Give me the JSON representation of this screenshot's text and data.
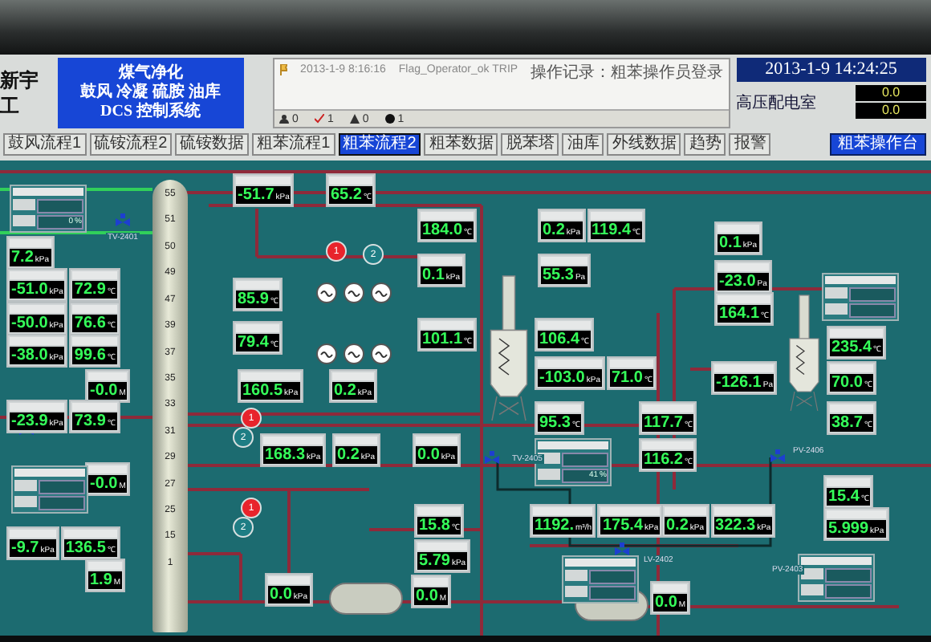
{
  "header": {
    "company": [
      "新宇",
      "工"
    ],
    "title_lines": [
      "煤气净化",
      "鼓风 冷凝 硫胺 油库",
      "DCS 控制系统"
    ],
    "event_log": {
      "entries": [
        {
          "time": "2013-1-9 8:16:16",
          "tag": "Flag_Operator_ok TRIP",
          "message": "操作记录：粗苯操作员登录"
        }
      ],
      "counters": [
        {
          "kind": "person",
          "count": "0"
        },
        {
          "kind": "check",
          "count": "1"
        },
        {
          "kind": "warning",
          "count": "0"
        },
        {
          "kind": "dot",
          "count": "1"
        }
      ]
    },
    "datetime": "2013-1-9 14:24:25",
    "substation": {
      "label": "高压配电室",
      "values": [
        "0.0",
        "0.0"
      ]
    }
  },
  "nav": [
    {
      "label": "鼓风流程1",
      "selected": false
    },
    {
      "label": "硫铵流程2",
      "selected": false
    },
    {
      "label": "硫铵数据",
      "selected": false
    },
    {
      "label": "粗苯流程1",
      "selected": false
    },
    {
      "label": "粗苯流程2",
      "selected": true
    },
    {
      "label": "粗苯数据",
      "selected": false
    },
    {
      "label": "脱苯塔",
      "selected": false
    },
    {
      "label": "油库",
      "selected": false
    },
    {
      "label": "外线数据",
      "selected": false
    },
    {
      "label": "趋势",
      "selected": false
    },
    {
      "label": "报警",
      "selected": false
    }
  ],
  "console_button": "粗苯操作台",
  "gauges": [
    {
      "cells": [
        {
          "value": "7.2",
          "unit": "kPa"
        }
      ]
    },
    {
      "cells": [
        {
          "value": "-51.0",
          "unit": "kPa"
        },
        {
          "value": "72.9",
          "unit": "℃"
        }
      ]
    },
    {
      "cells": [
        {
          "value": "-50.0",
          "unit": "kPa"
        },
        {
          "value": "76.6",
          "unit": "℃"
        }
      ]
    },
    {
      "cells": [
        {
          "value": "-38.0",
          "unit": "kPa"
        },
        {
          "value": "99.6",
          "unit": "℃"
        }
      ]
    },
    {
      "cells": [
        {
          "value": "-0.0",
          "unit": "M"
        }
      ]
    },
    {
      "cells": [
        {
          "value": "-23.9",
          "unit": "kPa"
        },
        {
          "value": "73.9",
          "unit": "℃"
        }
      ]
    },
    {
      "cells": [
        {
          "value": "-0.0",
          "unit": "M"
        }
      ]
    },
    {
      "cells": [
        {
          "value": "-9.7",
          "unit": "kPa"
        },
        {
          "value": "136.5",
          "unit": "℃"
        }
      ]
    },
    {
      "cells": [
        {
          "value": "1.9",
          "unit": "M"
        }
      ]
    },
    {
      "cells": [
        {
          "value": "-51.7",
          "unit": "kPa"
        }
      ]
    },
    {
      "cells": [
        {
          "value": "85.9",
          "unit": "℃"
        }
      ]
    },
    {
      "cells": [
        {
          "value": "79.4",
          "unit": "℃"
        }
      ]
    },
    {
      "cells": [
        {
          "value": "160.5",
          "unit": "kPa"
        }
      ]
    },
    {
      "cells": [
        {
          "value": "168.3",
          "unit": "kPa"
        }
      ]
    },
    {
      "cells": [
        {
          "value": "0.0",
          "unit": "kPa"
        }
      ]
    },
    {
      "cells": [
        {
          "value": "65.2",
          "unit": "℃"
        }
      ]
    },
    {
      "cells": [
        {
          "value": "184.0",
          "unit": "℃"
        }
      ]
    },
    {
      "cells": [
        {
          "value": "0.1",
          "unit": "kPa"
        }
      ]
    },
    {
      "cells": [
        {
          "value": "101.1",
          "unit": "℃"
        }
      ]
    },
    {
      "cells": [
        {
          "value": "0.2",
          "unit": "kPa"
        }
      ]
    },
    {
      "cells": [
        {
          "value": "0.2",
          "unit": "kPa"
        }
      ]
    },
    {
      "cells": [
        {
          "value": "0.0",
          "unit": "kPa"
        }
      ]
    },
    {
      "cells": [
        {
          "value": "15.8",
          "unit": "℃"
        }
      ]
    },
    {
      "cells": [
        {
          "value": "5.79",
          "unit": "kPa"
        }
      ]
    },
    {
      "cells": [
        {
          "value": "0.0",
          "unit": "M"
        }
      ]
    },
    {
      "cells": [
        {
          "value": "0.2",
          "unit": "kPa"
        },
        {
          "value": "119.4",
          "unit": "℃"
        }
      ]
    },
    {
      "cells": [
        {
          "value": "55.3",
          "unit": "Pa"
        }
      ]
    },
    {
      "cells": [
        {
          "value": "106.4",
          "unit": "℃"
        }
      ]
    },
    {
      "cells": [
        {
          "value": "-103.0",
          "unit": "kPa"
        },
        {
          "value": "71.0",
          "unit": "℃"
        }
      ]
    },
    {
      "cells": [
        {
          "value": "95.3",
          "unit": "℃"
        }
      ]
    },
    {
      "cells": [
        {
          "value": "1192.",
          "unit": "m³/h"
        },
        {
          "value": "175.4",
          "unit": "kPa"
        }
      ]
    },
    {
      "cells": [
        {
          "value": "117.7",
          "unit": "℃"
        }
      ]
    },
    {
      "cells": [
        {
          "value": "116.2",
          "unit": "℃"
        }
      ]
    },
    {
      "cells": [
        {
          "value": "0.1",
          "unit": "kPa"
        }
      ]
    },
    {
      "cells": [
        {
          "value": "-23.0",
          "unit": "Pa"
        }
      ]
    },
    {
      "cells": [
        {
          "value": "164.1",
          "unit": "℃"
        }
      ]
    },
    {
      "cells": [
        {
          "value": "-126.1",
          "unit": "Pa"
        }
      ]
    },
    {
      "cells": [
        {
          "value": "235.4",
          "unit": "℃"
        }
      ]
    },
    {
      "cells": [
        {
          "value": "70.0",
          "unit": "℃"
        }
      ]
    },
    {
      "cells": [
        {
          "value": "38.7",
          "unit": "℃"
        }
      ]
    },
    {
      "cells": [
        {
          "value": "15.4",
          "unit": "℃"
        }
      ]
    },
    {
      "cells": [
        {
          "value": "0.2",
          "unit": "kPa"
        },
        {
          "value": "322.3",
          "unit": "kPa"
        }
      ]
    },
    {
      "cells": [
        {
          "value": "5.999",
          "unit": "kPa"
        }
      ]
    },
    {
      "cells": [
        {
          "value": "0.0",
          "unit": "M"
        }
      ]
    }
  ],
  "controllers": [
    {
      "rows": [
        {
          "value": "0",
          "unit": "%"
        }
      ]
    },
    {
      "rows": [
        {
          "value": "41",
          "unit": "%"
        }
      ]
    }
  ],
  "column_trays": [
    "55",
    "51",
    "50",
    "49",
    "47",
    "39",
    "37",
    "35",
    "33",
    "31",
    "29",
    "27",
    "25",
    "15",
    "1"
  ],
  "pumps": [
    {
      "label": "1",
      "running": true
    },
    {
      "label": "2",
      "running": false
    },
    {
      "label": "1",
      "running": true
    },
    {
      "label": "2",
      "running": false
    },
    {
      "label": "1",
      "running": true
    },
    {
      "label": "2",
      "running": false
    }
  ],
  "tags": [
    "TV-2401",
    "TV-2405",
    "LV-2402",
    "PV-2406",
    "PV-2403"
  ]
}
